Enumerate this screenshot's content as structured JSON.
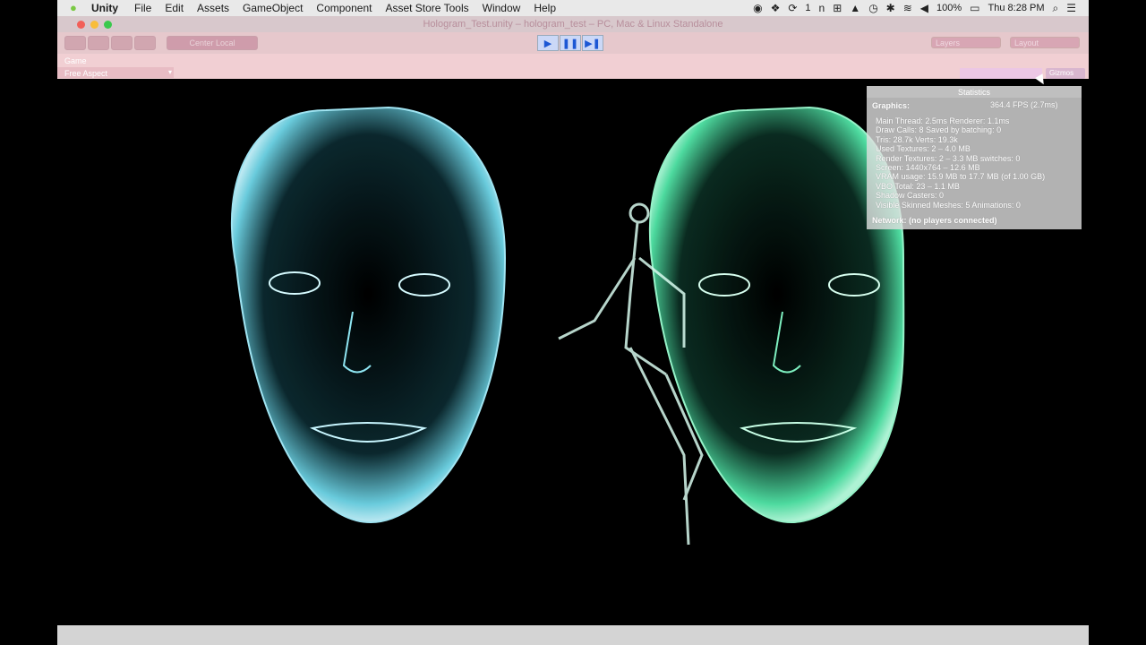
{
  "menubar": {
    "app": "Unity",
    "items": [
      "File",
      "Edit",
      "Assets",
      "GameObject",
      "Component",
      "Asset Store Tools",
      "Window",
      "Help"
    ],
    "battery": "100%",
    "clock": "Thu 8:28 PM",
    "badge": "1"
  },
  "window": {
    "title": "Hologram_Test.unity – hologram_test – PC, Mac & Linux Standalone"
  },
  "toolbar": {
    "pivot_label": "Center  Local",
    "layers_label": "Layers",
    "layout_label": "Layout"
  },
  "game": {
    "tab_label": "Game",
    "aspect_label": "Free Aspect",
    "gizmos_label": "Gizmos"
  },
  "stats": {
    "header": "Statistics",
    "graphics_label": "Graphics:",
    "fps": "364.4 FPS (2.7ms)",
    "lines": [
      "Main Thread: 2.5ms  Renderer: 1.1ms",
      "Draw Calls: 8  Saved by batching: 0",
      "Tris: 28.7k    Verts: 19.3k",
      "Used Textures: 2 – 4.0 MB",
      "Render Textures: 2 – 3.3 MB  switches: 0",
      "Screen: 1440x764 – 12.6 MB",
      "VRAM usage: 15.9 MB to 17.7 MB (of 1.00 GB)",
      "VBO Total: 23 – 1.1 MB",
      "Shadow Casters: 0",
      "Visible Skinned Meshes: 5      Animations: 0"
    ],
    "network": "Network: (no players connected)"
  },
  "colors": {
    "hologram_cyan": "#7fe9f2",
    "hologram_green": "#5df0b0",
    "play_blue": "#1c57d4"
  }
}
